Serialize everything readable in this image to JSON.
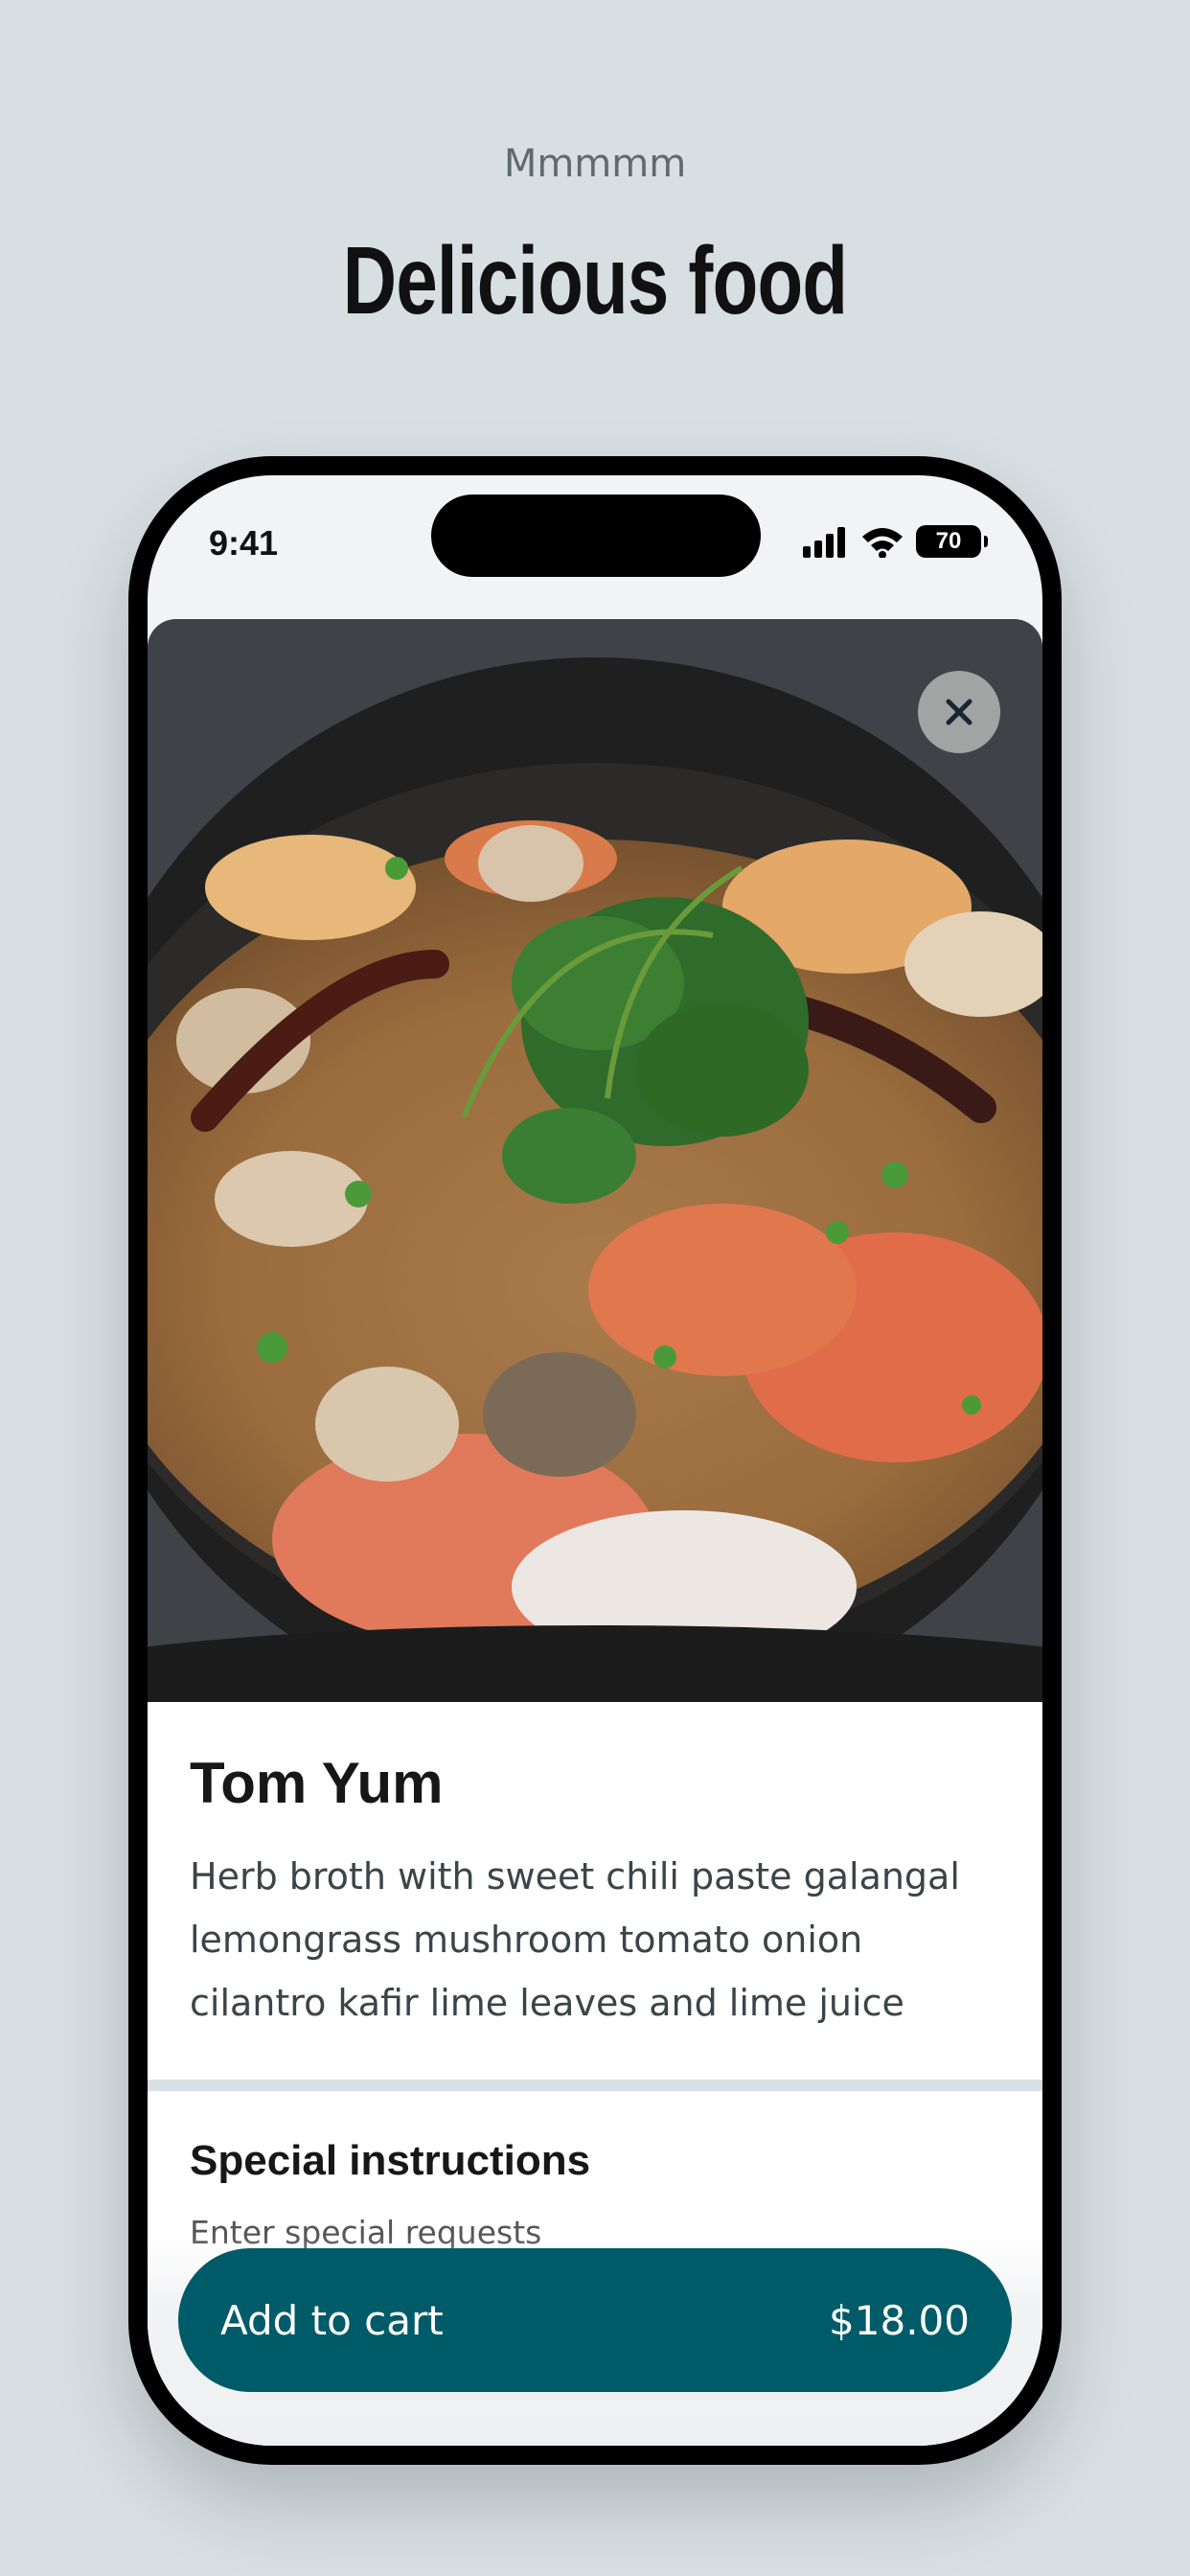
{
  "header": {
    "eyebrow": "Mmmmm",
    "title": "Delicious food"
  },
  "status_bar": {
    "time": "9:41",
    "battery": "70"
  },
  "item": {
    "name": "Tom Yum",
    "description": "Herb broth with sweet chili paste galangal lemongrass mushroom tomato onion cilantro kafir lime leaves and lime juice",
    "photo_alt": "Tom Yum soup"
  },
  "special_instructions": {
    "title": "Special instructions",
    "placeholder": "Enter special requests"
  },
  "cart": {
    "label": "Add to cart",
    "price": "$18.00"
  },
  "colors": {
    "background": "#d7dfe2",
    "accent": "#005b68",
    "divider": "#d9e1e4"
  },
  "icons": [
    "signal-icon",
    "wifi-icon",
    "battery-icon",
    "close-icon"
  ]
}
